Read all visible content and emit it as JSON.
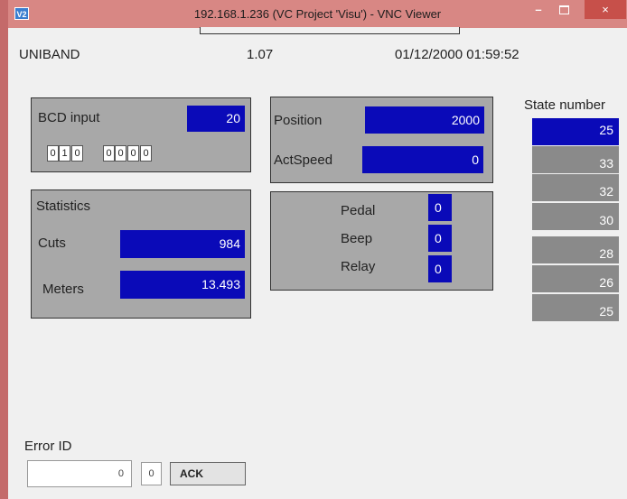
{
  "window": {
    "title": "192.168.1.236 (VC Project 'Visu') - VNC Viewer",
    "logo": "V2",
    "controls": {
      "minimize": "–",
      "close": "×"
    }
  },
  "header": {
    "name": "UNIBAND",
    "version": "1.07",
    "datetime": "01/12/2000 01:59:52"
  },
  "bcd": {
    "label": "BCD input",
    "value": "20",
    "bits": [
      "0",
      "1",
      "0",
      "0",
      "0",
      "0",
      "0"
    ]
  },
  "position": {
    "label": "Position",
    "value": "2000"
  },
  "actspeed": {
    "label": "ActSpeed",
    "value": "0"
  },
  "statistics": {
    "title": "Statistics",
    "cuts_label": "Cuts",
    "cuts_value": "984",
    "meters_label": "Meters",
    "meters_value": "13.493"
  },
  "io": {
    "pedal_label": "Pedal",
    "pedal_value": "0",
    "beep_label": "Beep",
    "beep_value": "0",
    "relay_label": "Relay",
    "relay_value": "0"
  },
  "state": {
    "title": "State number",
    "values": [
      "25",
      "33",
      "32",
      "30",
      "28",
      "26",
      "25"
    ]
  },
  "error": {
    "label": "Error ID",
    "value": "0",
    "code": "0",
    "ack_label": "ACK"
  },
  "colors": {
    "value_blue": "#0a0ab8",
    "panel_gray": "#a8a8a8",
    "state_gray": "#8a8a8a",
    "titlebar": "#d88784"
  }
}
